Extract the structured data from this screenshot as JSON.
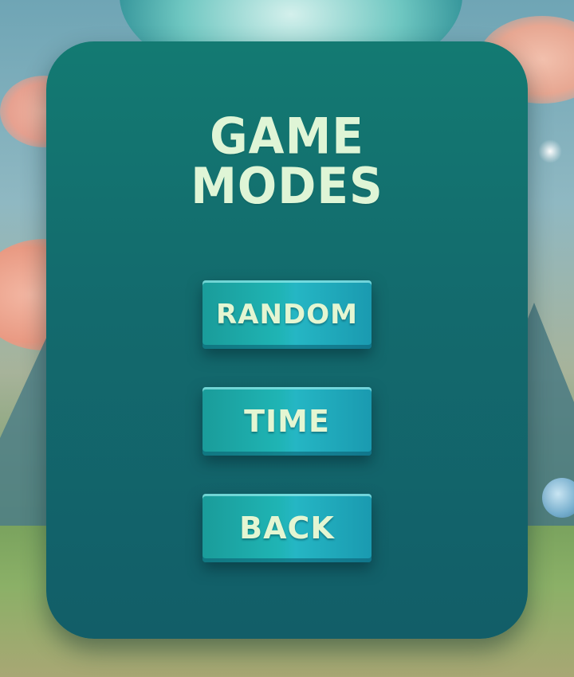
{
  "menu": {
    "title_line1": "GAME",
    "title_line2": "MODES"
  },
  "buttons": {
    "random": "RANDOM",
    "time": "TIME",
    "back": "BACK"
  },
  "colors": {
    "panel": "#136a6d",
    "button": "#1fb4b4",
    "text": "#dff5d6"
  }
}
